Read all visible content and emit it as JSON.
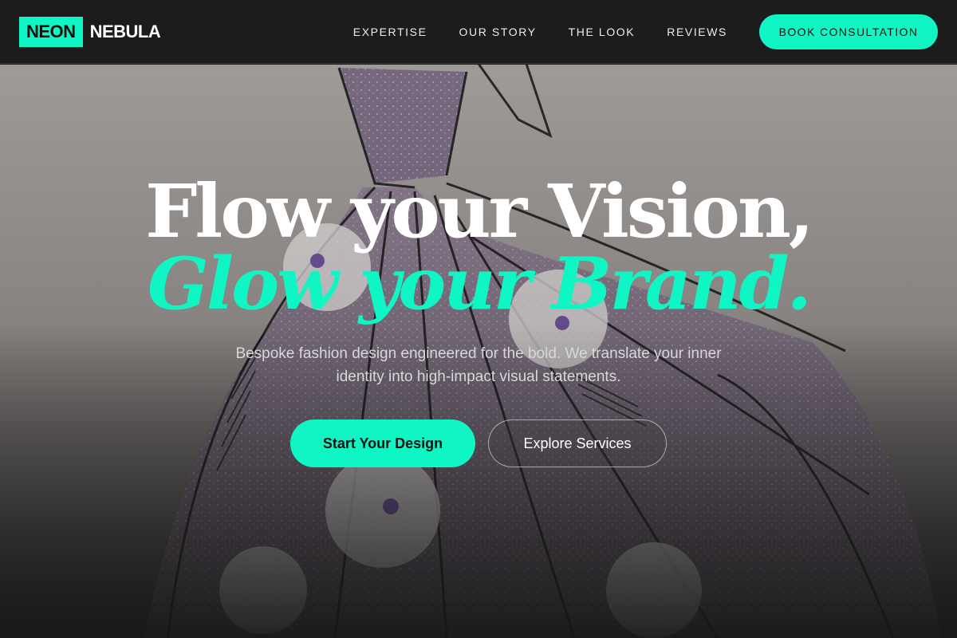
{
  "brand": {
    "part1": "NEON",
    "part2": "NEBULA",
    "accent_color": "#10f5c4"
  },
  "nav": {
    "links": [
      "EXPERTISE",
      "OUR STORY",
      "THE LOOK",
      "REVIEWS"
    ],
    "cta_label": "BOOK CONSULTATION"
  },
  "hero": {
    "headline_line1": "Flow your Vision,",
    "headline_line2": "Glow your Brand.",
    "subtext": "Bespoke fashion design engineered for the bold. We translate your inner identity into high-impact visual statements.",
    "primary_button": "Start Your Design",
    "secondary_button": "Explore Services",
    "background_image": "fashion-gown-sketch"
  }
}
